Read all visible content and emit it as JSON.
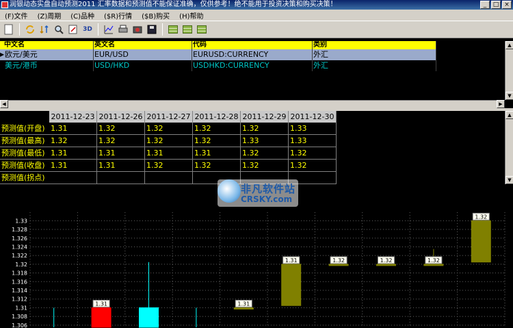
{
  "window": {
    "title": "润银动态实盘自动预测2011 汇率数据和预测值不能保证准确，仅供参考！绝不能用于投资决策和购买决策！",
    "buttons": [
      "_",
      "□",
      "×"
    ]
  },
  "menu": {
    "items": [
      "(F)文件",
      "(Z)周期",
      "(C)品种",
      "($R)行情",
      "($B)购买",
      "(H)帮助"
    ]
  },
  "toolbar": {
    "icons": [
      "new-icon",
      "refresh-icon",
      "sort-icon",
      "zoom-icon",
      "edit-icon",
      "3d-label",
      "chart-icon",
      "print-icon",
      "camera-icon",
      "save-icon",
      "table-green-icon",
      "table-green-icon",
      "table-green-icon"
    ],
    "label_3d": "3D"
  },
  "instruments": {
    "headers": [
      "中文名",
      "英文名",
      "代码",
      "类别"
    ],
    "rows": [
      {
        "cn": "欧元/美元",
        "en": "EUR/USD",
        "code": "EURUSD:CURRENCY",
        "category": "外汇"
      },
      {
        "cn": "美元/港币",
        "en": "USD/HKD",
        "code": "USDHKD:CURRENCY",
        "category": "外汇"
      }
    ],
    "selected_index": 0
  },
  "forecast": {
    "dates": [
      "2011-12-23",
      "2011-12-26",
      "2011-12-27",
      "2011-12-28",
      "2011-12-29",
      "2011-12-30"
    ],
    "rows": [
      {
        "label": "预测值(开盘)",
        "values": [
          "1.31",
          "1.32",
          "1.32",
          "1.32",
          "1.32",
          "1.33"
        ]
      },
      {
        "label": "预测值(最高)",
        "values": [
          "1.32",
          "1.32",
          "1.32",
          "1.32",
          "1.33",
          "1.33"
        ]
      },
      {
        "label": "预测值(最低)",
        "values": [
          "1.31",
          "1.31",
          "1.31",
          "1.31",
          "1.32",
          "1.32"
        ]
      },
      {
        "label": "预测值(收盘)",
        "values": [
          "1.31",
          "1.31",
          "1.32",
          "1.32",
          "1.32",
          "1.32"
        ]
      },
      {
        "label": "预测值(拐点)",
        "values": [
          "",
          "",
          "",
          "",
          "",
          ""
        ]
      }
    ]
  },
  "watermark": {
    "cn": "非凡软件站",
    "en": "CRSKY.com"
  },
  "chart_data": {
    "type": "candlestick",
    "y_ticks": [
      "1.33",
      "1.328",
      "1.326",
      "1.324",
      "1.322",
      "1.32",
      "1.318",
      "1.316",
      "1.314",
      "1.312",
      "1.31",
      "1.308",
      "1.306"
    ],
    "ylim": [
      1.3055,
      1.331
    ],
    "grid": true,
    "colors": {
      "up": "#ff0000",
      "down": "#00ffff",
      "forecast": "#808000",
      "grid": "#606060",
      "axis_text": "#ffffff"
    },
    "candles": [
      {
        "slot": 0,
        "open": null,
        "high": 1.31,
        "low": 1.3055,
        "close": null,
        "label": ""
      },
      {
        "slot": 1,
        "open": 1.3055,
        "high": 1.311,
        "low": 1.3055,
        "close": 1.31,
        "label": "1.31",
        "color": "up"
      },
      {
        "slot": 2,
        "open": 1.31,
        "high": 1.3205,
        "low": 1.3055,
        "close": 1.3055,
        "label": "",
        "color": "down"
      },
      {
        "slot": 3,
        "open": null,
        "high": 1.31,
        "low": 1.3055,
        "close": null,
        "label": ""
      },
      {
        "slot": 4,
        "open": 1.31,
        "high": 1.31,
        "low": 1.31,
        "close": 1.31,
        "label": "1.31",
        "color": "forecast"
      },
      {
        "slot": 5,
        "open": 1.3105,
        "high": 1.32,
        "low": 1.3105,
        "close": 1.32,
        "label": "1.31",
        "color": "forecast"
      },
      {
        "slot": 6,
        "open": 1.32,
        "high": 1.32,
        "low": 1.32,
        "close": 1.32,
        "label": "1.32",
        "color": "forecast"
      },
      {
        "slot": 7,
        "open": 1.32,
        "high": 1.32,
        "low": 1.32,
        "close": 1.32,
        "label": "1.32",
        "color": "forecast"
      },
      {
        "slot": 8,
        "open": 1.32,
        "high": 1.3235,
        "low": 1.32,
        "close": 1.32,
        "label": "1.32",
        "color": "forecast"
      },
      {
        "slot": 9,
        "open": 1.3205,
        "high": 1.33,
        "low": 1.3205,
        "close": 1.33,
        "label": "1.32",
        "color": "forecast"
      }
    ]
  }
}
